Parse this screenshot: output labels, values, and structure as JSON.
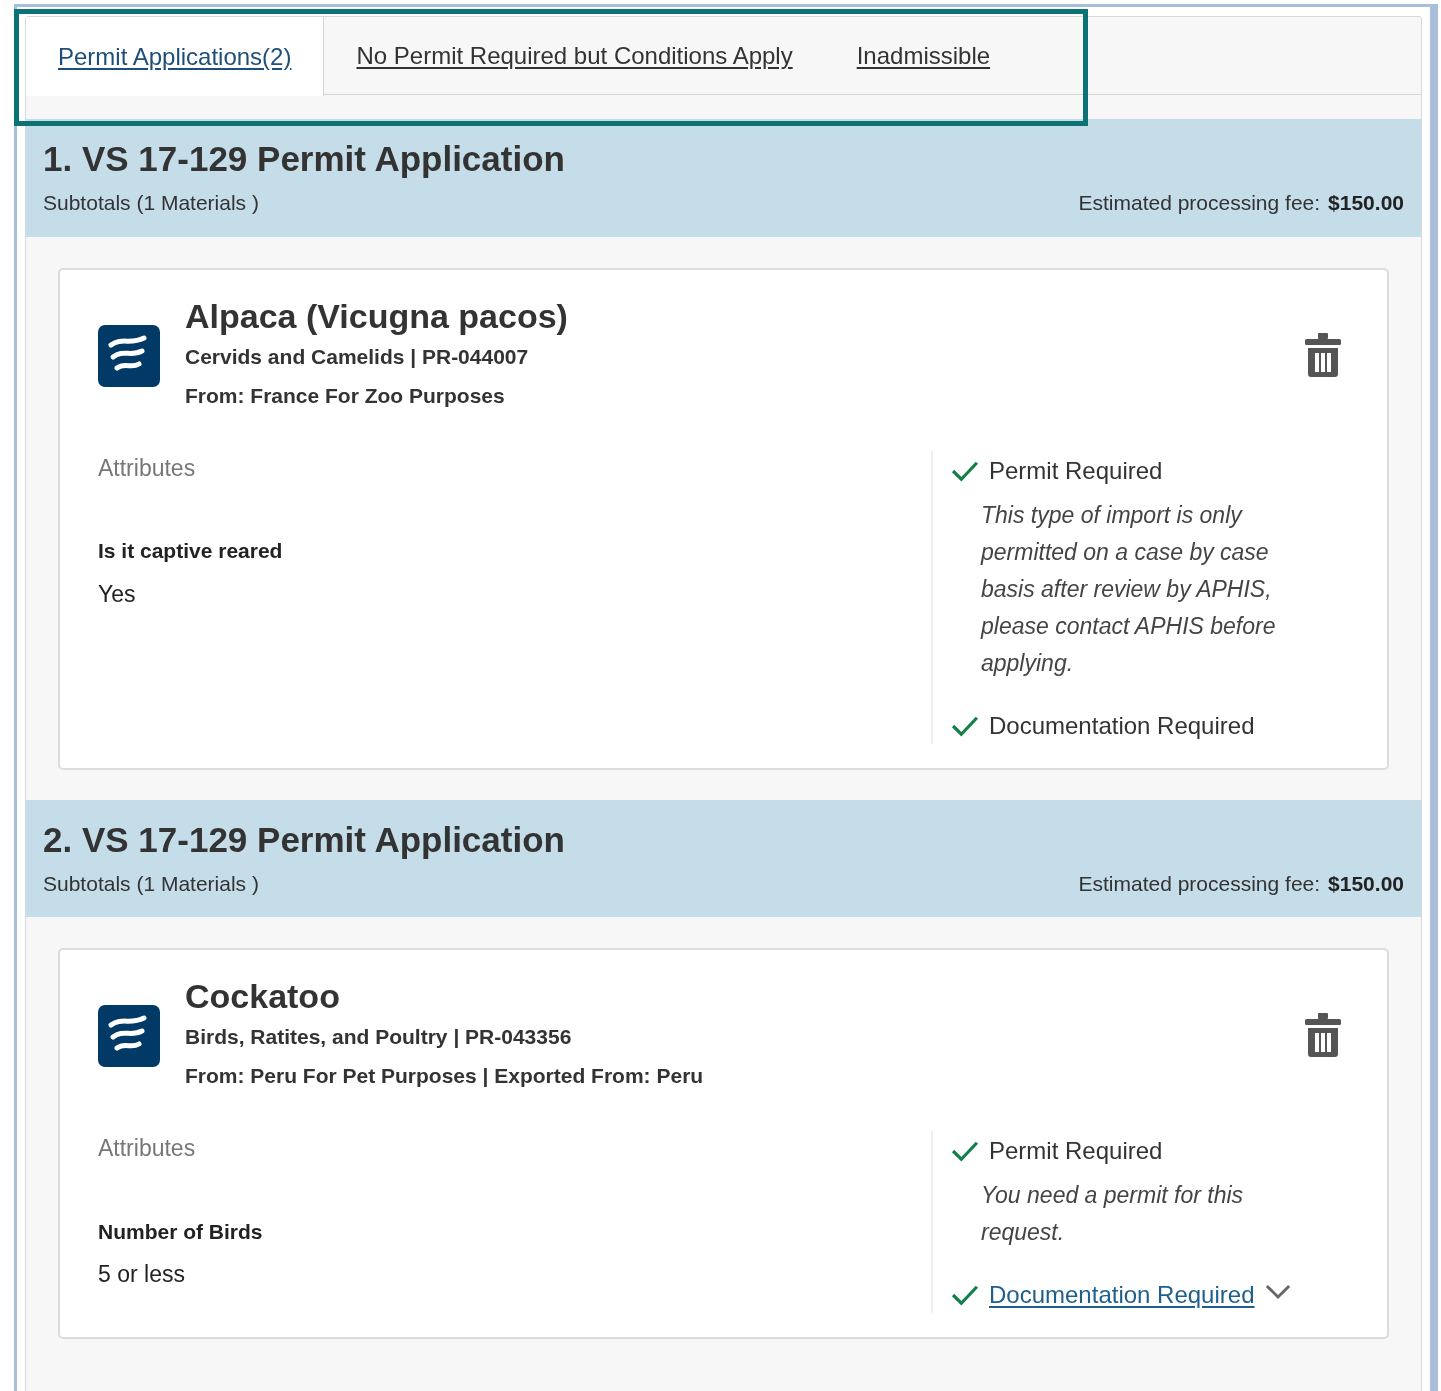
{
  "tabs": [
    {
      "label": "Permit Applications(2)",
      "selected": true
    },
    {
      "label": "No Permit Required but Conditions Apply",
      "selected": false
    },
    {
      "label": "Inadmissible",
      "selected": false
    }
  ],
  "applications": [
    {
      "title": "1. VS 17-129 Permit Application",
      "subtotal": "Subtotals (1 Materials )",
      "fee_label": "Estimated processing fee:",
      "fee": "$150.00",
      "items": [
        {
          "name": "Alpaca (Vicugna pacos)",
          "category": "Cervids and Camelids | PR-044007",
          "origin": "From: France For Zoo Purposes",
          "attributes_label": "Attributes",
          "attributes": [
            {
              "name": "Is it captive reared",
              "value": "Yes"
            }
          ],
          "requirements": [
            {
              "kind": "plain",
              "label": "Permit Required",
              "note": "This type of import is only permitted on a case by case basis after review by APHIS, please contact APHIS before applying."
            },
            {
              "kind": "plain",
              "label": "Documentation Required"
            }
          ]
        }
      ]
    },
    {
      "title": "2. VS 17-129 Permit Application",
      "subtotal": "Subtotals (1 Materials )",
      "fee_label": "Estimated processing fee:",
      "fee": "$150.00",
      "items": [
        {
          "name": "Cockatoo",
          "category": "Birds, Ratites, and Poultry | PR-043356",
          "origin": "From: Peru For Pet Purposes | Exported From: Peru",
          "attributes_label": "Attributes",
          "attributes": [
            {
              "name": "Number of Birds",
              "value": "5 or less"
            }
          ],
          "requirements": [
            {
              "kind": "plain",
              "label": "Permit Required",
              "note": "You need a permit for this request."
            },
            {
              "kind": "link",
              "label": "Documentation Required",
              "expanded": false
            }
          ]
        }
      ]
    }
  ]
}
